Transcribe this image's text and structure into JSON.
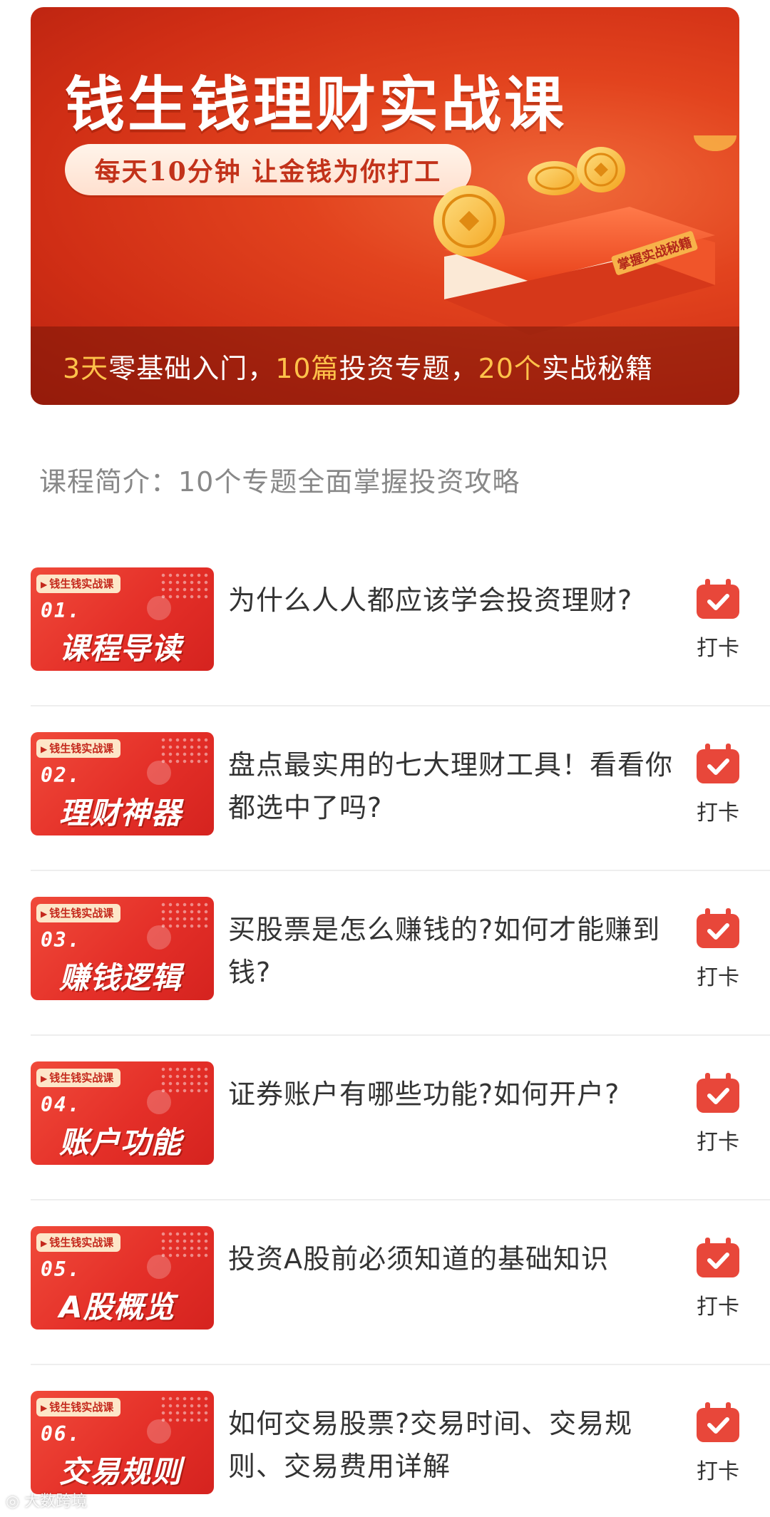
{
  "banner": {
    "title": "钱生钱理财实战课",
    "slogan": "每天10分钟 让金钱为你打工",
    "book_spine_text": "掌握实战秘籍",
    "features": [
      {
        "highlight": "3天",
        "text": "零基础入门，"
      },
      {
        "highlight": "10篇",
        "text": "投资专题，"
      },
      {
        "highlight": "20个",
        "text": "实战秘籍"
      }
    ]
  },
  "intro": "课程简介：10个专题全面掌握投资攻略",
  "lessons": [
    {
      "tag": "钱生钱实战课",
      "num": "01.",
      "thumb_title": "课程导读",
      "title": "为什么人人都应该学会投资理财?",
      "checkin": "打卡"
    },
    {
      "tag": "钱生钱实战课",
      "num": "02.",
      "thumb_title": "理财神器",
      "title": "盘点最实用的七大理财工具！看看你都选中了吗?",
      "checkin": "打卡"
    },
    {
      "tag": "钱生钱实战课",
      "num": "03.",
      "thumb_title": "赚钱逻辑",
      "title": "买股票是怎么赚钱的?如何才能赚到钱?",
      "checkin": "打卡"
    },
    {
      "tag": "钱生钱实战课",
      "num": "04.",
      "thumb_title": "账户功能",
      "title": "证券账户有哪些功能?如何开户?",
      "checkin": "打卡"
    },
    {
      "tag": "钱生钱实战课",
      "num": "05.",
      "thumb_title": "A股概览",
      "title": "投资A股前必须知道的基础知识",
      "checkin": "打卡"
    },
    {
      "tag": "钱生钱实战课",
      "num": "06.",
      "thumb_title": "交易规则",
      "title": "如何交易股票?交易时间、交易规则、交易费用详解",
      "checkin": "打卡"
    }
  ],
  "watermark": "大数跨境",
  "colors": {
    "brand_red": "#e2431e",
    "highlight": "#ffc24a",
    "checkin_red": "#e8473a"
  }
}
